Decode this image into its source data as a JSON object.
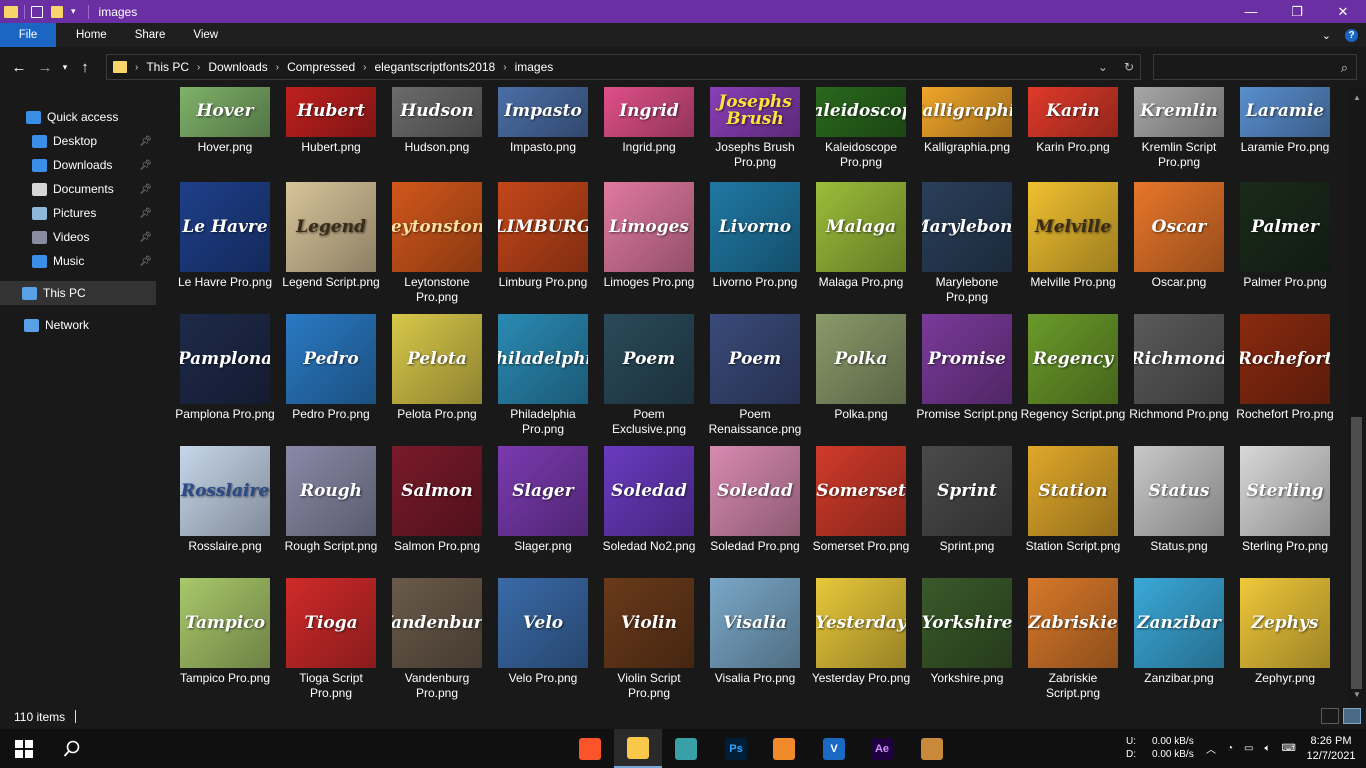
{
  "window": {
    "title": "images",
    "controls": {
      "minimize": "—",
      "maximize": "❐",
      "close": "✕"
    }
  },
  "ribbon": {
    "tabs": [
      "File",
      "Home",
      "Share",
      "View"
    ]
  },
  "address": {
    "crumbs": [
      "This PC",
      "Downloads",
      "Compressed",
      "elegantscriptfonts2018",
      "images"
    ],
    "search_placeholder": ""
  },
  "nav": {
    "items": [
      {
        "label": "Quick access",
        "icon": "star-icon",
        "color": "#3a8ee6",
        "pinned": false
      },
      {
        "label": "Desktop",
        "icon": "desktop-icon",
        "color": "#3a8ee6",
        "pinned": true
      },
      {
        "label": "Downloads",
        "icon": "download-icon",
        "color": "#3a8ee6",
        "pinned": true
      },
      {
        "label": "Documents",
        "icon": "document-icon",
        "color": "#d6d6d6",
        "pinned": true
      },
      {
        "label": "Pictures",
        "icon": "pictures-icon",
        "color": "#8fb7dc",
        "pinned": true
      },
      {
        "label": "Videos",
        "icon": "videos-icon",
        "color": "#8a8aa0",
        "pinned": true
      },
      {
        "label": "Music",
        "icon": "music-icon",
        "color": "#3a8ee6",
        "pinned": true
      },
      {
        "label": "This PC",
        "icon": "computer-icon",
        "color": "#5aa0e6",
        "pinned": false
      },
      {
        "label": "Network",
        "icon": "network-icon",
        "color": "#5aa0e6",
        "pinned": false
      }
    ]
  },
  "files": [
    [
      {
        "name": "Hover.png",
        "text": "Hover",
        "bg": "#7fb36a",
        "fg": "#ffffff"
      },
      {
        "name": "Hubert.png",
        "text": "Hubert",
        "bg": "#c0201f",
        "fg": "#ffffff"
      },
      {
        "name": "Hudson.png",
        "text": "Hudson",
        "bg": "#6c6c6c",
        "fg": "#ffffff"
      },
      {
        "name": "Impasto.png",
        "text": "Impasto",
        "bg": "#4b6fa8",
        "fg": "#ffffff"
      },
      {
        "name": "Ingrid.png",
        "text": "Ingrid",
        "bg": "#e0508a",
        "fg": "#ffffff"
      },
      {
        "name": "Josephs Brush Pro.png",
        "text": "Josephs Brush",
        "bg": "#8a3fb8",
        "fg": "#ffe23a"
      },
      {
        "name": "Kaleidoscope Pro.png",
        "text": "Kaleidoscope",
        "bg": "#2a6a1e",
        "fg": "#ffffff"
      },
      {
        "name": "Kalligraphia.png",
        "text": "Kalligraphia",
        "bg": "#f2a62a",
        "fg": "#ffffff"
      },
      {
        "name": "Karin Pro.png",
        "text": "Karin",
        "bg": "#e03a2a",
        "fg": "#ffffff"
      },
      {
        "name": "Kremlin Script Pro.png",
        "text": "Kremlin",
        "bg": "#a8a8a8",
        "fg": "#ffffff"
      },
      {
        "name": "Laramie Pro.png",
        "text": "Laramie",
        "bg": "#5a8fd0",
        "fg": "#ffffff"
      }
    ],
    [
      {
        "name": "Le Havre Pro.png",
        "text": "Le Havre",
        "bg": "#1e3f8a",
        "fg": "#ffffff"
      },
      {
        "name": "Legend Script.png",
        "text": "Legend",
        "bg": "#d8c49a",
        "fg": "#3a2a18"
      },
      {
        "name": "Leytonstone Pro.png",
        "text": "Leytonstone",
        "bg": "#d2571b",
        "fg": "#ffe0a0"
      },
      {
        "name": "Limburg Pro.png",
        "text": "LIMBURG",
        "bg": "#c4461a",
        "fg": "#ffffff"
      },
      {
        "name": "Limoges Pro.png",
        "text": "Limoges",
        "bg": "#e07aa0",
        "fg": "#ffffff"
      },
      {
        "name": "Livorno Pro.png",
        "text": "Livorno",
        "bg": "#1f78a4",
        "fg": "#ffffff"
      },
      {
        "name": "Malaga Pro.png",
        "text": "Malaga",
        "bg": "#9bbd3a",
        "fg": "#ffffff"
      },
      {
        "name": "Marylebone Pro.png",
        "text": "Marylebone",
        "bg": "#2a3f5a",
        "fg": "#ffffff"
      },
      {
        "name": "Melville Pro.png",
        "text": "Melville",
        "bg": "#f0c030",
        "fg": "#3a2a18"
      },
      {
        "name": "Oscar.png",
        "text": "Oscar",
        "bg": "#e8762a",
        "fg": "#ffffff"
      },
      {
        "name": "Palmer Pro.png",
        "text": "Palmer",
        "bg": "#1a2a1a",
        "fg": "#ffffff"
      }
    ],
    [
      {
        "name": "Pamplona Pro.png",
        "text": "Pamplona",
        "bg": "#1e2a4a",
        "fg": "#ffffff"
      },
      {
        "name": "Pedro Pro.png",
        "text": "Pedro",
        "bg": "#2a7ac4",
        "fg": "#ffffff"
      },
      {
        "name": "Pelota Pro.png",
        "text": "Pelota",
        "bg": "#d8c84a",
        "fg": "#ffffff"
      },
      {
        "name": "Philadelphia Pro.png",
        "text": "Philadelphia",
        "bg": "#2a8ab4",
        "fg": "#ffffff"
      },
      {
        "name": "Poem Exclusive.png",
        "text": "Poem",
        "bg": "#2a4a5a",
        "fg": "#ffffff"
      },
      {
        "name": "Poem Renaissance.png",
        "text": "Poem",
        "bg": "#3a4a7a",
        "fg": "#ffffff"
      },
      {
        "name": "Polka.png",
        "text": "Polka",
        "bg": "#8a9a6a",
        "fg": "#ffffff"
      },
      {
        "name": "Promise Script.png",
        "text": "Promise",
        "bg": "#7a3a9a",
        "fg": "#ffffff"
      },
      {
        "name": "Regency Script.png",
        "text": "Regency",
        "bg": "#6a9a2a",
        "fg": "#ffffff"
      },
      {
        "name": "Richmond Pro.png",
        "text": "Richmond",
        "bg": "#5a5a5a",
        "fg": "#ffffff"
      },
      {
        "name": "Rochefort Pro.png",
        "text": "Rochefort",
        "bg": "#8a2a10",
        "fg": "#ffffff"
      }
    ],
    [
      {
        "name": "Rosslaire.png",
        "text": "Rosslaire",
        "bg": "#c6d6ea",
        "fg": "#2a4a8a"
      },
      {
        "name": "Rough Script.png",
        "text": "Rough",
        "bg": "#8a8aa8",
        "fg": "#ffffff"
      },
      {
        "name": "Salmon Pro.png",
        "text": "Salmon",
        "bg": "#7a1a2a",
        "fg": "#ffffff"
      },
      {
        "name": "Slager.png",
        "text": "Slager",
        "bg": "#7a3ab0",
        "fg": "#ffffff"
      },
      {
        "name": "Soledad No2.png",
        "text": "Soledad",
        "bg": "#6a3ac0",
        "fg": "#ffffff"
      },
      {
        "name": "Soledad Pro.png",
        "text": "Soledad",
        "bg": "#d88ab0",
        "fg": "#ffffff"
      },
      {
        "name": "Somerset Pro.png",
        "text": "Somerset",
        "bg": "#d03a2a",
        "fg": "#ffffff"
      },
      {
        "name": "Sprint.png",
        "text": "Sprint",
        "bg": "#4a4a4a",
        "fg": "#ffffff"
      },
      {
        "name": "Station Script.png",
        "text": "Station",
        "bg": "#e0a82a",
        "fg": "#ffffff"
      },
      {
        "name": "Status.png",
        "text": "Status",
        "bg": "#c8c8c8",
        "fg": "#ffffff"
      },
      {
        "name": "Sterling Pro.png",
        "text": "Sterling",
        "bg": "#d8d8d8",
        "fg": "#ffffff"
      }
    ],
    [
      {
        "name": "Tampico Pro.png",
        "text": "Tampico",
        "bg": "#a8c86a",
        "fg": "#ffffff"
      },
      {
        "name": "Tioga Script Pro.png",
        "text": "Tioga",
        "bg": "#d02a2a",
        "fg": "#ffffff"
      },
      {
        "name": "Vandenburg Pro.png",
        "text": "Vandenburg",
        "bg": "#6a5a4a",
        "fg": "#ffffff"
      },
      {
        "name": "Velo Pro.png",
        "text": "Velo",
        "bg": "#3a6aa8",
        "fg": "#ffffff"
      },
      {
        "name": "Violin Script Pro.png",
        "text": "Violin",
        "bg": "#6a3a1a",
        "fg": "#ffffff"
      },
      {
        "name": "Visalia Pro.png",
        "text": "Visalia",
        "bg": "#7aa8c8",
        "fg": "#ffffff"
      },
      {
        "name": "Yesterday Pro.png",
        "text": "Yesterday",
        "bg": "#e8c83a",
        "fg": "#ffffff"
      },
      {
        "name": "Yorkshire.png",
        "text": "Yorkshire",
        "bg": "#3a5a2a",
        "fg": "#ffffff"
      },
      {
        "name": "Zabriskie Script.png",
        "text": "Zabriskie",
        "bg": "#d8782a",
        "fg": "#ffffff"
      },
      {
        "name": "Zanzibar.png",
        "text": "Zanzibar",
        "bg": "#3aa8d8",
        "fg": "#ffffff"
      },
      {
        "name": "Zephyr.png",
        "text": "Zephys",
        "bg": "#f0c83a",
        "fg": "#ffffff"
      }
    ]
  ],
  "status": {
    "item_count": "110 items"
  },
  "taskbar": {
    "apps": [
      {
        "name": "brave-icon",
        "label": "",
        "bg": "#fb542b"
      },
      {
        "name": "file-explorer-icon",
        "label": "",
        "bg": "#f7c84a"
      },
      {
        "name": "app-icon",
        "label": "",
        "bg": "#3aa0a8"
      },
      {
        "name": "photoshop-icon",
        "label": "Ps",
        "bg": "#001e36"
      },
      {
        "name": "fl-studio-icon",
        "label": "",
        "bg": "#f08a2a"
      },
      {
        "name": "visual-studio-icon",
        "label": "V",
        "bg": "#1a6ac4"
      },
      {
        "name": "after-effects-icon",
        "label": "Ae",
        "bg": "#1f0040"
      },
      {
        "name": "winrar-icon",
        "label": "",
        "bg": "#c88a3a"
      }
    ],
    "net_up": "U:",
    "net_down": "D:",
    "up_speed": "0.00 kB/s",
    "down_speed": "0.00 kB/s",
    "time": "8:26 PM",
    "date": "12/7/2021"
  }
}
